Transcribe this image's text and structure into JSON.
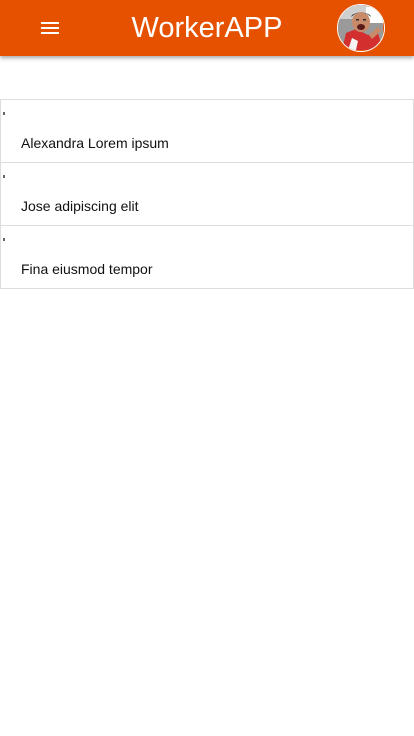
{
  "header": {
    "title": "WorkerAPP",
    "menu_icon": "menu-icon",
    "avatar_icon": "user-avatar",
    "accent_color": "#e65100"
  },
  "workers": [
    {
      "name": "Alexandra Lorem ipsum"
    },
    {
      "name": "Jose adipiscing elit"
    },
    {
      "name": "Fina eiusmod tempor"
    }
  ]
}
